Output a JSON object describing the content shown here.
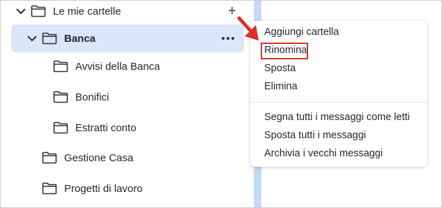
{
  "folders": {
    "root": {
      "label": "Le mie cartelle",
      "add_symbol": "+"
    },
    "banca": {
      "label": "Banca"
    },
    "children": [
      {
        "label": "Avvisi della Banca"
      },
      {
        "label": "Bonifici"
      },
      {
        "label": "Estratti conto"
      }
    ],
    "others": [
      {
        "label": "Gestione Casa"
      },
      {
        "label": "Progetti di lavoro"
      }
    ]
  },
  "context_menu": {
    "group1": [
      {
        "label": "Aggiungi cartella"
      },
      {
        "label": "Rinomina",
        "highlighted": true
      },
      {
        "label": "Sposta"
      },
      {
        "label": "Elimina"
      }
    ],
    "group2": [
      {
        "label": "Segna tutti i messaggi come letti"
      },
      {
        "label": "Sposta tutti i messaggi"
      },
      {
        "label": "Archivia i vecchi messaggi"
      }
    ]
  },
  "colors": {
    "selected_row": "#dbe6fb",
    "divider": "#c6d8f7",
    "annotation_red": "#d9302b"
  },
  "icons": {
    "expand": "chevron-down-icon",
    "folder": "folder-icon",
    "add": "plus-icon",
    "more": "more-options-icon",
    "pointer": "red-arrow-icon"
  }
}
